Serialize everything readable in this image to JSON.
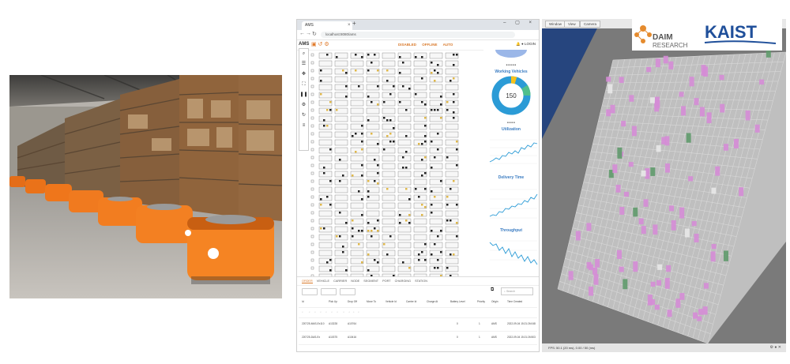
{
  "browser": {
    "tab_title": "AMS",
    "url": "localhost:8080/ams",
    "app_name": "AMS",
    "modes": [
      "DISABLED",
      "OFFLINE",
      "AUTO"
    ],
    "user_label": "LOGIN"
  },
  "side_panels": {
    "working_vehicles": {
      "title": "Working Vehicles",
      "center_value": "150"
    },
    "utilization": {
      "title": "Utilization"
    },
    "delivery_time": {
      "title": "Delivery Time"
    },
    "throughput": {
      "title": "Throughput"
    }
  },
  "bottom_tabs": [
    "ORDER",
    "VEHICLE",
    "CARRIER",
    "NODE",
    "SEGMENT",
    "PORT",
    "CHARGING STATION"
  ],
  "search_placeholder": "Search",
  "table": {
    "headers": [
      "Id",
      "Pick Up",
      "Drop Off",
      "Move To",
      "Vehicle Id",
      "Carrier Id",
      "Charge At",
      "Battery Level",
      "Priority",
      "Origin",
      "Time Created"
    ],
    "rows": [
      [
        "220725-MAS-Ex110",
        "A13228",
        "A10764",
        "",
        "",
        "",
        "",
        "0",
        "1",
        "AMS",
        "2022-09-04 15:21:26:048"
      ],
      [
        "220725-DAS-Ex",
        "A10375",
        "A10416",
        "",
        "",
        "",
        "",
        "0",
        "1",
        "AMS",
        "2022-09-04 15:21:26:503"
      ]
    ]
  },
  "sim": {
    "tabs": [
      "Window",
      "View",
      "Camera"
    ],
    "status": "FPS: 50.1 (20 ms), 0.00 / 50 (ms)"
  },
  "logos": {
    "daim_line1": "DAIM",
    "daim_line2": "RESEARCH",
    "kaist": "KAIST"
  },
  "colors": {
    "robot_orange": "#f07a1f",
    "accent": "#d9792a",
    "chart_blue": "#2b9bd6",
    "sim_pink": "#d58cd6"
  }
}
